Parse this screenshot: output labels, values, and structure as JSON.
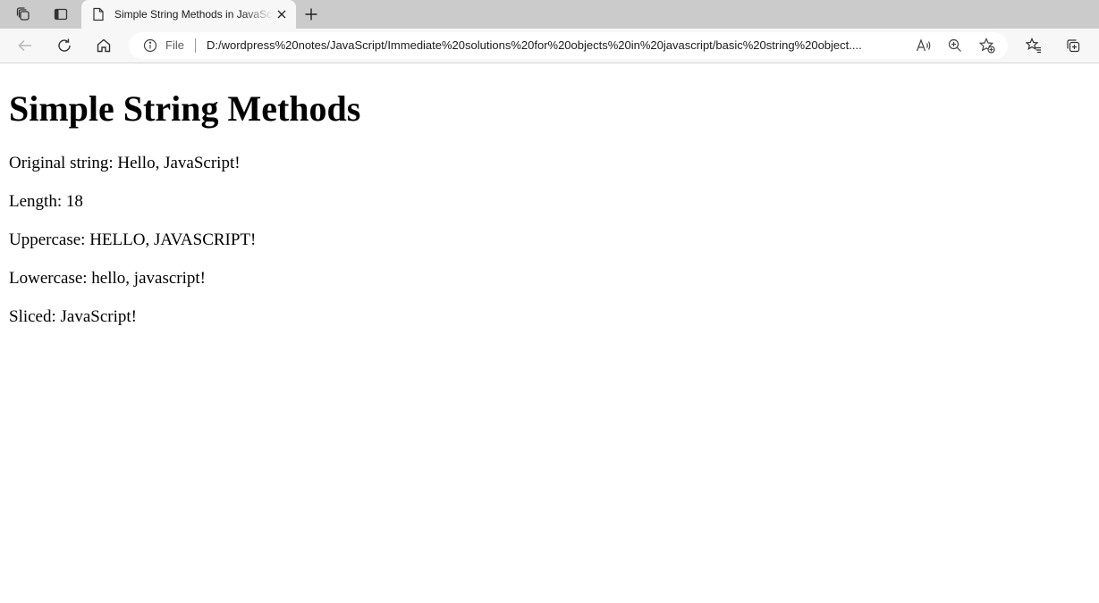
{
  "browser": {
    "tab": {
      "title": "Simple String Methods in JavaScript"
    },
    "address_bar": {
      "scheme_label": "File",
      "url": "D:/wordpress%20notes/JavaScript/Immediate%20solutions%20for%20objects%20in%20javascript/basic%20string%20object...."
    },
    "icons": {
      "tab_actions": "tab-actions-icon",
      "vertical_tabs": "vertical-tabs-icon",
      "page": "page-icon",
      "close": "close-icon",
      "new_tab": "plus-icon",
      "back": "back-arrow-icon",
      "refresh": "refresh-icon",
      "home": "home-icon",
      "info": "info-icon",
      "read_aloud": "read-aloud-icon",
      "zoom": "zoom-icon",
      "add_favorite": "add-favorite-icon",
      "favorites": "favorites-icon",
      "collections": "collections-icon"
    }
  },
  "page": {
    "heading": "Simple String Methods",
    "lines": [
      "Original string: Hello, JavaScript!",
      "Length: 18",
      "Uppercase: HELLO, JAVASCRIPT!",
      "Lowercase: hello, javascript!",
      "Sliced: JavaScript!"
    ]
  },
  "colors": {
    "tabstrip": "#cbcbcb",
    "toolbar": "#f7f7f7",
    "page_background": "#ffffff",
    "text": "#000000"
  }
}
